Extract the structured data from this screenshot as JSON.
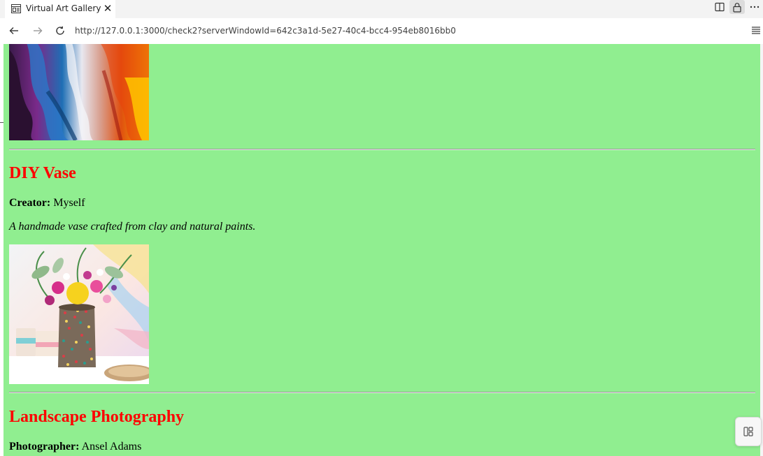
{
  "browser": {
    "tab_title": "Virtual Art Gallery",
    "tab_close": "✕",
    "address": "http://127.0.0.1:3000/check2?serverWindowId=642c3a1d-5e27-40c4-bcc4-954eb8016bb0",
    "icons": {
      "tab": "gallery-page-icon",
      "close": "close-icon",
      "split": "split-screen-icon",
      "lock": "lock-icon",
      "more": "more-options-icon",
      "back": "back-arrow-icon",
      "forward": "forward-arrow-icon",
      "reload": "reload-icon",
      "menu": "hamburger-menu-icon"
    }
  },
  "page": {
    "background": "#90ee90",
    "title_color": "#ff0000",
    "artworks": [
      {
        "image_alt": "abstract colorful painting",
        "image_partially_visible": true
      },
      {
        "title": "DIY Vase",
        "creator_label": "Creator:",
        "creator": "Myself",
        "description": "A handmade vase crafted from clay and natural paints.",
        "image_alt": "handmade vase with flowers"
      },
      {
        "title": "Landscape Photography",
        "creator_label": "Photographer:",
        "creator": "Ansel Adams"
      }
    ]
  },
  "floating_button_icon": "sidebar-panel-icon"
}
